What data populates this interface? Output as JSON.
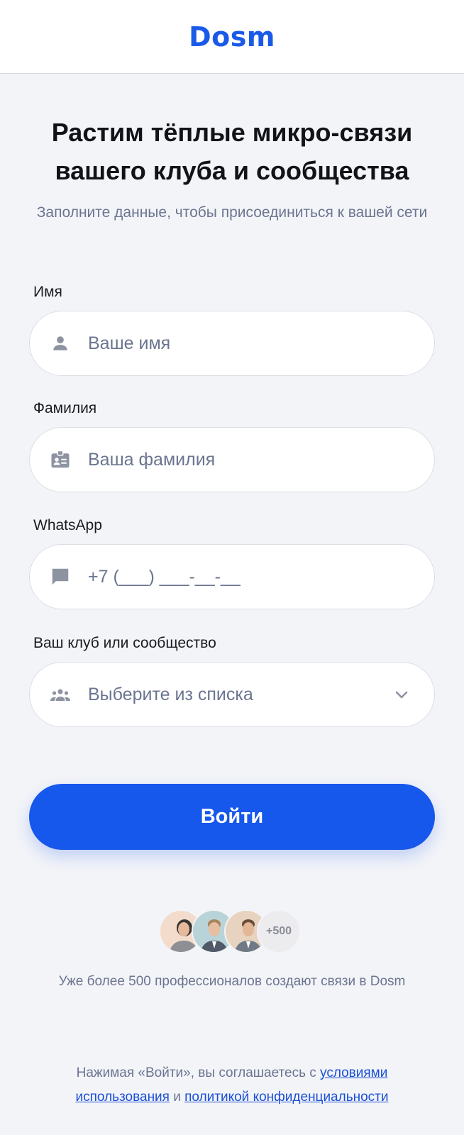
{
  "header": {
    "logo": "Dosm"
  },
  "hero": {
    "title_line1": "Растим тёплые микро-связи",
    "title_line2": "вашего клуба и сообщества",
    "subtitle": "Заполните данные, чтобы присоединиться к вашей сети"
  },
  "form": {
    "first_name": {
      "label": "Имя",
      "placeholder": "Ваше имя",
      "icon": "person-icon"
    },
    "last_name": {
      "label": "Фамилия",
      "placeholder": "Ваша фамилия",
      "icon": "id-badge-icon"
    },
    "whatsapp": {
      "label": "WhatsApp",
      "placeholder": "+7 (___) ___-__-__",
      "icon": "chat-bubble-icon"
    },
    "community": {
      "label": "Ваш клуб или сообщество",
      "placeholder": "Выберите из списка",
      "icon": "group-icon"
    },
    "submit_label": "Войти"
  },
  "social_proof": {
    "more_badge": "+500",
    "text": "Уже более 500 профессионалов создают связи в Dosm"
  },
  "legal": {
    "prefix": "Нажимая «Войти», вы соглашаетесь с ",
    "terms_link": "условиями использования",
    "conjunction": " и ",
    "privacy_link": "политикой конфиденциальности"
  },
  "colors": {
    "accent": "#1658ec",
    "background": "#f3f4f8",
    "muted_text": "#6b7590"
  }
}
